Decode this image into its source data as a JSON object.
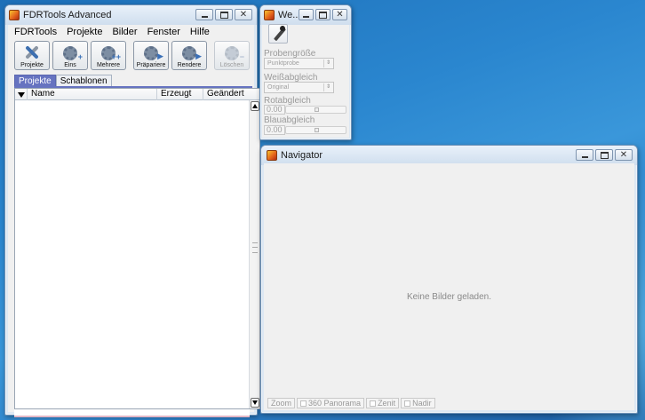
{
  "main_window": {
    "title": "FDRTools Advanced",
    "menu": [
      "FDRTools",
      "Projekte",
      "Bilder",
      "Fenster",
      "Hilfe"
    ],
    "toolbar": {
      "projekte": "Projekte",
      "eins": "Eins",
      "mehrere": "Mehrere",
      "praepariere": "Präpariere",
      "rendere": "Rendere",
      "loeschen": "Löschen"
    },
    "tabs": [
      "Projekte",
      "Schablonen"
    ],
    "columns": [
      "Name",
      "Erzeugt",
      "Geändert"
    ]
  },
  "wb_window": {
    "title": "We...",
    "probengroesse_label": "Probengröße",
    "probengroesse_value": "Punktprobe",
    "weissabgleich_label": "Weißabgleich",
    "weissabgleich_value": "Original",
    "rotabgleich_label": "Rotabgleich",
    "rotabgleich_value": "0.00",
    "blauabgleich_label": "Blauabgleich",
    "blauabgleich_value": "0.00"
  },
  "navigator": {
    "title": "Navigator",
    "empty_message": "Keine Bilder geladen.",
    "zoom": "Zoom",
    "panorama": "360 Panorama",
    "zenit": "Zenit",
    "nadir": "Nadir"
  },
  "colors": {
    "desktop": "#2a86cf",
    "tab_active": "#6673c0",
    "window_frame": "#dde8f3"
  }
}
